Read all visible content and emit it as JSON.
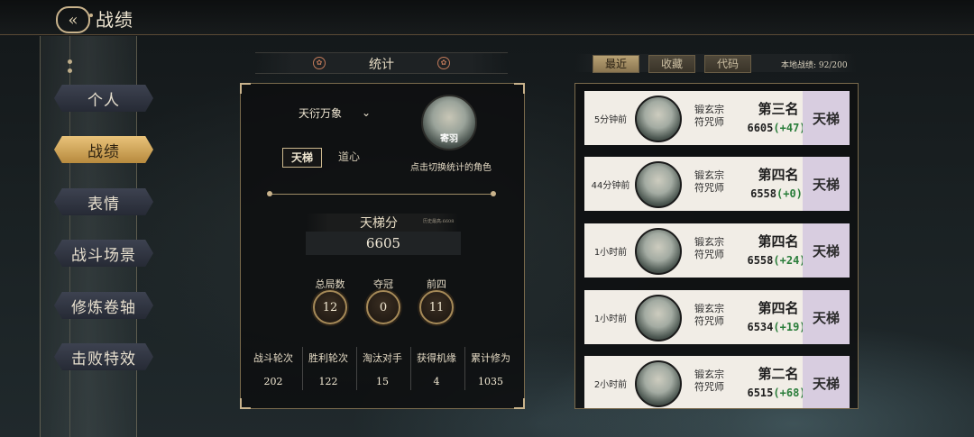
{
  "header": {
    "title": "战绩",
    "back_icon": "back-arrow-icon"
  },
  "nav": {
    "items": [
      {
        "label": "个人",
        "active": false
      },
      {
        "label": "战绩",
        "active": true
      },
      {
        "label": "表情",
        "active": false
      },
      {
        "label": "战斗场景",
        "active": false
      },
      {
        "label": "修炼卷轴",
        "active": false
      },
      {
        "label": "击败特效",
        "active": false
      }
    ]
  },
  "stats": {
    "section_title": "统计",
    "role_select": {
      "value": "天衍万象",
      "icon": "chevron-down-icon"
    },
    "tabs": [
      {
        "label": "天梯",
        "active": true
      },
      {
        "label": "道心",
        "active": false
      }
    ],
    "avatar": {
      "name": "寄羽",
      "hint": "点击切换统计的角色"
    },
    "ladder": {
      "label": "天梯分",
      "history_label": "历史最高:6608",
      "value": "6605"
    },
    "badges": [
      {
        "label": "总局数",
        "value": "12"
      },
      {
        "label": "夺冠",
        "value": "0"
      },
      {
        "label": "前四",
        "value": "11"
      }
    ],
    "summary": [
      {
        "label": "战斗轮次",
        "value": "202"
      },
      {
        "label": "胜利轮次",
        "value": "122"
      },
      {
        "label": "淘汰对手",
        "value": "15"
      },
      {
        "label": "获得机缘",
        "value": "4"
      },
      {
        "label": "累计修为",
        "value": "1035"
      }
    ]
  },
  "records_tabs": [
    {
      "label": "最近",
      "active": true
    },
    {
      "label": "收藏",
      "active": false
    },
    {
      "label": "代码",
      "active": false
    }
  ],
  "local_record": "本地战绩: 92/200",
  "records": [
    {
      "time": "5分钟前",
      "sect": "锻玄宗",
      "role": "符咒师",
      "rank": "第三名",
      "score": "6605",
      "delta": "(+47)",
      "mode": "天梯"
    },
    {
      "time": "44分钟前",
      "sect": "锻玄宗",
      "role": "符咒师",
      "rank": "第四名",
      "score": "6558",
      "delta": "(+0)",
      "mode": "天梯"
    },
    {
      "time": "1小时前",
      "sect": "锻玄宗",
      "role": "符咒师",
      "rank": "第四名",
      "score": "6558",
      "delta": "(+24)",
      "mode": "天梯"
    },
    {
      "time": "1小时前",
      "sect": "锻玄宗",
      "role": "符咒师",
      "rank": "第四名",
      "score": "6534",
      "delta": "(+19)",
      "mode": "天梯"
    },
    {
      "time": "2小时前",
      "sect": "锻玄宗",
      "role": "符咒师",
      "rank": "第二名",
      "score": "6515",
      "delta": "(+68)",
      "mode": "天梯"
    }
  ],
  "colors": {
    "accent_gold": "#e9c37a",
    "delta_green": "#2a7d3a",
    "mode_bg": "#d8cde0"
  }
}
